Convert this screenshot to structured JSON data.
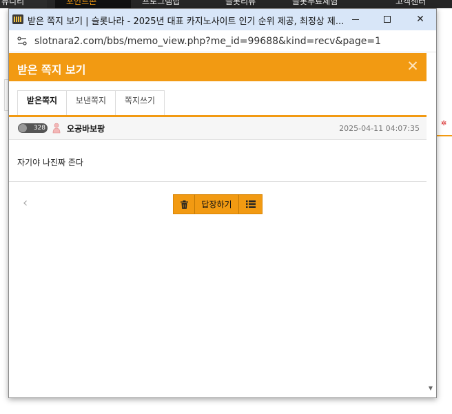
{
  "background": {
    "nav_items": [
      "뮤니티",
      "포인트존",
      "프로그램팁",
      "슬롯리뷰",
      "슬롯무료체험",
      "고객센터"
    ]
  },
  "window": {
    "title": "받은 쪽지 보기 | 슬롯나라 - 2025년 대표 카지노사이트 인기 순위 제공, 최정상 제...",
    "url": "slotnara2.com/bbs/memo_view.php?me_id=99688&kind=recv&page=1",
    "minimize_symbol": "—",
    "maximize_symbol": "☐",
    "close_symbol": "✕"
  },
  "popup": {
    "heading": "받은 쪽지 보기",
    "close_symbol": "✕",
    "tabs": [
      {
        "label": "받은쪽지",
        "active": true
      },
      {
        "label": "보낸쪽지",
        "active": false
      },
      {
        "label": "쪽지쓰기",
        "active": false
      }
    ],
    "message": {
      "level_badge": "328",
      "sender": "오공바보팡",
      "date": "2025-04-11 04:07:35",
      "body": "자기야 나진짜 존다"
    },
    "buttons": {
      "delete_icon": "trash-icon",
      "reply_label": "답장하기",
      "list_icon": "list-icon"
    },
    "prev_symbol": "‹"
  },
  "colors": {
    "accent": "#f29a12",
    "titlebar": "#d8e6f8",
    "background_nav": "#262626"
  }
}
